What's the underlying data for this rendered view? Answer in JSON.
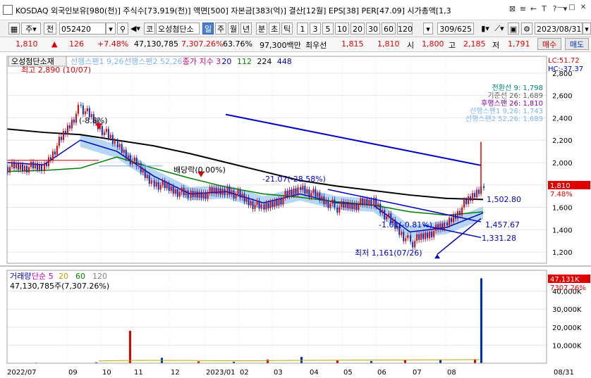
{
  "window": {
    "title": "KOSDAQ 외국인보유[980(천)] 주식수[73,919(천)] 액면[500] 자본금[383(억)] 결산[12월] EPS[38] PER[47.09] 시가총액[1,3",
    "title_buttons": [
      "⊠",
      "≡",
      "←",
      "T",
      "?",
      "▾"
    ],
    "win_buttons": [
      "—",
      "□",
      "✕"
    ]
  },
  "toolbar": {
    "type_label": "주",
    "type2_label": "전",
    "code": "052420",
    "market_label": "코",
    "stock_name": "오성첨단소",
    "periods": [
      "일",
      "주",
      "월",
      "년",
      "분",
      "초",
      "틱"
    ],
    "active_period": "일",
    "intervals": [
      "1",
      "3",
      "5",
      "10",
      "20",
      "30",
      "60",
      "120"
    ],
    "page": "309/625",
    "date": "2023/08/31"
  },
  "quote": {
    "price": "1,810",
    "change": "126",
    "change_pct": "+7.48%",
    "volume": "47,130,785",
    "vol_pct": "7,307.26%",
    "vol_ratio": "63.76%",
    "amount": "97,300백만",
    "pref_label": "최우선",
    "ask": "1,815",
    "bid": "1,810",
    "open_label": "시",
    "open": "1,800",
    "high_label": "고",
    "high": "2,185",
    "low_label": "저",
    "low": "1,791",
    "buy_label": "매수",
    "sell_label": "매도"
  },
  "price_panel": {
    "stock_tag": "오성첨단소재",
    "legend": [
      {
        "text": "선행스팬1 9,26",
        "color": "#7fb2f0"
      },
      {
        "text": "선행스팬2 52,26",
        "color": "#7fb2f0"
      },
      {
        "text": "종가 지수 3",
        "color": "#c00080"
      },
      {
        "text": "20",
        "color": "#0000c0"
      },
      {
        "text": "112",
        "color": "#008000"
      },
      {
        "text": "224",
        "color": "#000000"
      },
      {
        "text": "448",
        "color": "#0000c0"
      }
    ],
    "lc": "LC:51.72",
    "hc": "HC:-37.37",
    "max_label": "최고 2,890 (10/07)",
    "min_label": "최저 1,161(07/26)",
    "annotations": [
      {
        "text": "(-8.8%)",
        "color": "#000"
      },
      {
        "text": "배당락(0.00%)",
        "color": "#000"
      },
      {
        "text": "-21.07(-28.58%)",
        "color": "#0000c0"
      },
      {
        "text": "-1.01(-0.81%)",
        "color": "#0000c0"
      },
      {
        "text": "1,502.80",
        "color": "#0000c0"
      },
      {
        "text": "1,457.67",
        "color": "#0000c0"
      },
      {
        "text": "1,331.28",
        "color": "#0000c0"
      }
    ],
    "info": [
      {
        "text": "전환선 9: 1,798",
        "color": "#008080"
      },
      {
        "text": "기준선 26: 1,689",
        "color": "#606060"
      },
      {
        "text": "후행스팬 26: 1,810",
        "color": "#8000a0"
      },
      {
        "text": "선행스팬1 9,26: 1,743",
        "color": "#7fb2f0"
      },
      {
        "text": "선행스팬2 52,26: 1,689",
        "color": "#7fb2f0"
      }
    ],
    "y_ticks": [
      "2,800",
      "2,600",
      "2,400",
      "2,200",
      "2,000",
      "1,800",
      "1,600",
      "1,400",
      "1,200"
    ],
    "price_tag": "1,810",
    "pct_tag": "7.48%"
  },
  "volume_panel": {
    "legend": [
      {
        "text": "거래량",
        "color": "#0000c0"
      },
      {
        "text": "단순 5",
        "color": "#c000c0"
      },
      {
        "text": "20",
        "color": "#c0a000"
      },
      {
        "text": "60",
        "color": "#008000"
      },
      {
        "text": "120",
        "color": "#808080"
      }
    ],
    "value_label": "47,130,785주(7,307.26%)",
    "y_ticks": [
      "40,000K",
      "30,000K",
      "20,000K",
      "10,000K"
    ],
    "vol_tag": "47,131K",
    "pct_tag": "7307.26%"
  },
  "x_axis": {
    "labels": [
      "2022/07",
      "09",
      "10",
      "11",
      "12",
      "2023/01",
      "02",
      "03",
      "04",
      "05",
      "06",
      "07",
      "08"
    ],
    "right_label": "08/31"
  },
  "chart_data": {
    "type": "line",
    "x": [
      "2022/07",
      "2022/09",
      "2022/10",
      "2022/11",
      "2022/12",
      "2023/01",
      "2023/02",
      "2023/03",
      "2023/04",
      "2023/05",
      "2023/06",
      "2023/07",
      "2023/08",
      "2023/08/31"
    ],
    "series": [
      {
        "name": "종가",
        "values": [
          1960,
          1960,
          2500,
          2150,
          1820,
          1700,
          1760,
          1580,
          1780,
          1600,
          1650,
          1280,
          1450,
          1810
        ]
      },
      {
        "name": "20",
        "values": [
          2000,
          1980,
          2200,
          2100,
          1880,
          1720,
          1740,
          1640,
          1720,
          1640,
          1620,
          1380,
          1420,
          1550
        ]
      },
      {
        "name": "112",
        "values": [
          1920,
          1930,
          1950,
          2050,
          1950,
          1860,
          1780,
          1720,
          1690,
          1650,
          1620,
          1560,
          1530,
          1560
        ]
      },
      {
        "name": "224",
        "values": [
          2300,
          2270,
          2250,
          2200,
          2150,
          2080,
          2000,
          1920,
          1840,
          1790,
          1750,
          1710,
          1680,
          1670
        ]
      }
    ],
    "volume_values": [
      300,
      500,
      18000,
      3000,
      1000,
      800,
      2000,
      3500,
      1500,
      1200,
      1800,
      2000,
      2200,
      47131
    ],
    "ylim": [
      1100,
      2950
    ],
    "vol_ylim": [
      0,
      50000
    ]
  },
  "colors": {
    "up": "#e00000",
    "down": "#0030c0",
    "cloud": "#9ec9f0",
    "grid": "#e6e6e6"
  }
}
